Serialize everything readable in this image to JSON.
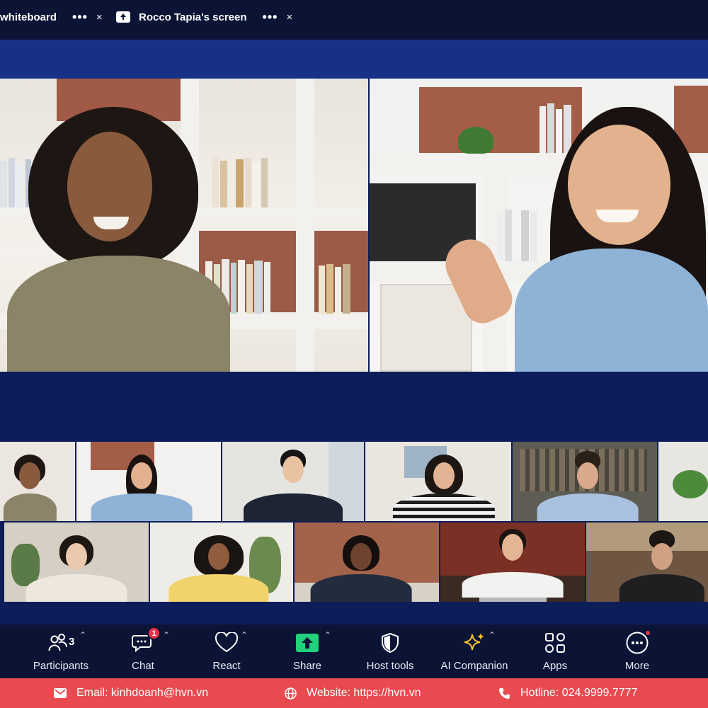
{
  "tabs": [
    {
      "label": "whiteboard",
      "more": "•••",
      "close": "×"
    },
    {
      "label": "Rocco Tapia's screen",
      "more": "•••",
      "close": "×",
      "icon": "share-screen-icon"
    }
  ],
  "toolbar": {
    "participants": {
      "label": "Participants",
      "count": "3",
      "icon": "participants-icon"
    },
    "chat": {
      "label": "Chat",
      "badge": "1",
      "icon": "chat-icon"
    },
    "react": {
      "label": "React",
      "icon": "heart-icon"
    },
    "share": {
      "label": "Share",
      "icon": "share-arrow-icon",
      "color": "#22d17b"
    },
    "host_tools": {
      "label": "Host tools",
      "icon": "shield-icon"
    },
    "ai_companion": {
      "label": "AI Companion",
      "icon": "sparkle-icon",
      "color": "#f4c430"
    },
    "apps": {
      "label": "Apps",
      "icon": "apps-icon"
    },
    "more": {
      "label": "More",
      "icon": "more-icon"
    },
    "caret": "⌃"
  },
  "footer": {
    "email": "Email: kinhdoanh@hvn.vn",
    "website": "Website: https://hvn.vn",
    "hotline": "Hotline: 024.9999.7777"
  },
  "colors": {
    "tab_bar": "#0b1435",
    "stage": "#0d1d5a",
    "stage_top": "#173187",
    "footer": "#e84a4f",
    "badge": "#e8334a"
  }
}
